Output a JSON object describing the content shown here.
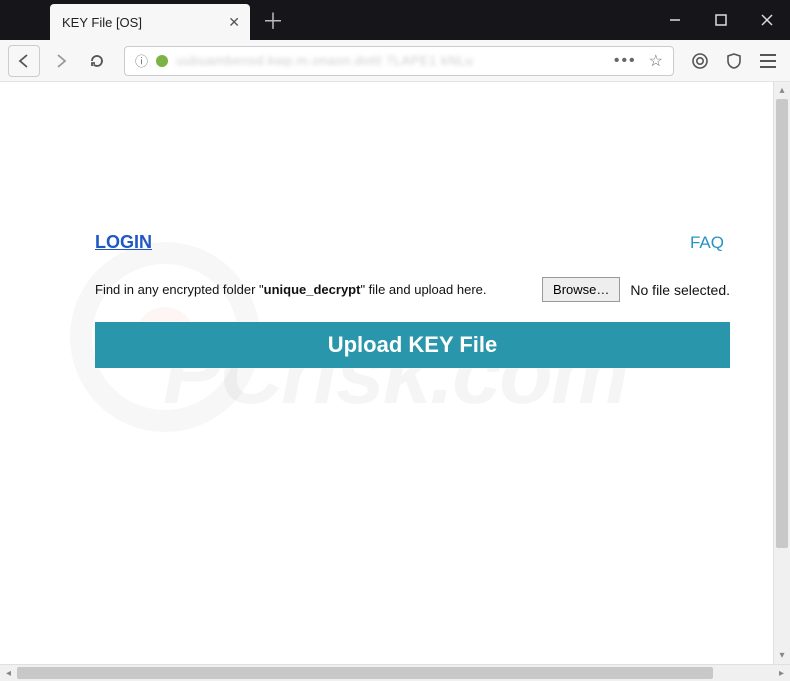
{
  "window": {
    "tab_title": "KEY File [OS]",
    "url_display": "uubuambensd.kwp.m.onaon.dottl 7LAPE1 kNLu"
  },
  "watermark": "PCrisk.com",
  "links": {
    "login": "LOGIN",
    "faq": "FAQ"
  },
  "instruction": {
    "before": "Find in any encrypted folder \"",
    "filename": "unique_decrypt",
    "after": "\" file and upload here."
  },
  "file_picker": {
    "browse": "Browse…",
    "status": "No file selected."
  },
  "upload_button": "Upload KEY File"
}
